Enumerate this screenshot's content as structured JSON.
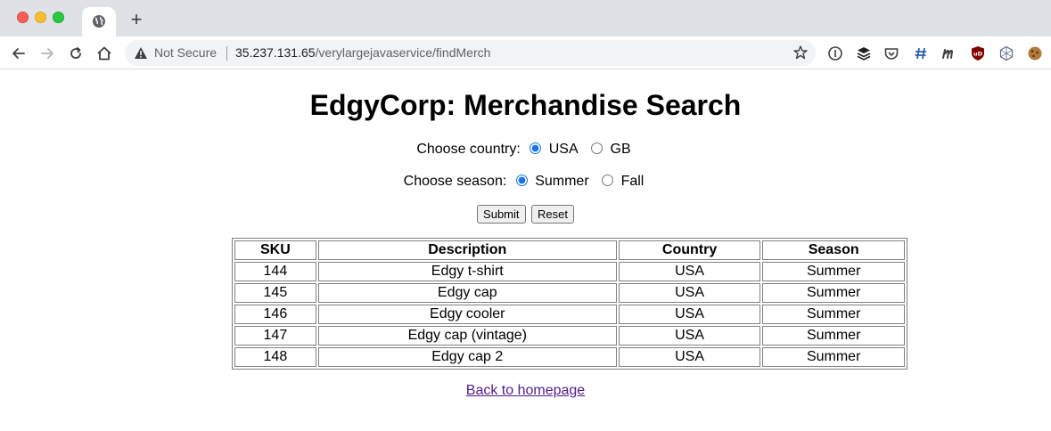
{
  "browser": {
    "new_tab_symbol": "+",
    "security_label": "Not Secure",
    "url_host": "35.237.131.65",
    "url_path": "/verylargejavaservice/findMerch",
    "extensions": [
      "info-icon",
      "layers-icon",
      "pocket-icon",
      "hashtag-icon",
      "m-icon",
      "ublock-icon",
      "hexagon-icon",
      "cookie-icon"
    ]
  },
  "page": {
    "title": "EdgyCorp: Merchandise Search",
    "country": {
      "label": "Choose country:",
      "options": [
        "USA",
        "GB"
      ],
      "selected": "USA"
    },
    "season": {
      "label": "Choose season:",
      "options": [
        "Summer",
        "Fall"
      ],
      "selected": "Summer"
    },
    "submit_label": "Submit",
    "reset_label": "Reset",
    "table": {
      "headers": [
        "SKU",
        "Description",
        "Country",
        "Season"
      ],
      "rows": [
        [
          "144",
          "Edgy t-shirt",
          "USA",
          "Summer"
        ],
        [
          "145",
          "Edgy cap",
          "USA",
          "Summer"
        ],
        [
          "146",
          "Edgy cooler",
          "USA",
          "Summer"
        ],
        [
          "147",
          "Edgy cap (vintage)",
          "USA",
          "Summer"
        ],
        [
          "148",
          "Edgy cap 2",
          "USA",
          "Summer"
        ]
      ]
    },
    "back_link": "Back to homepage"
  },
  "colors": {
    "tabbar": "#dee1e6",
    "omnibox": "#f1f3f4",
    "link_visited": "#551a8b",
    "radio_accent": "#1a73e8"
  }
}
